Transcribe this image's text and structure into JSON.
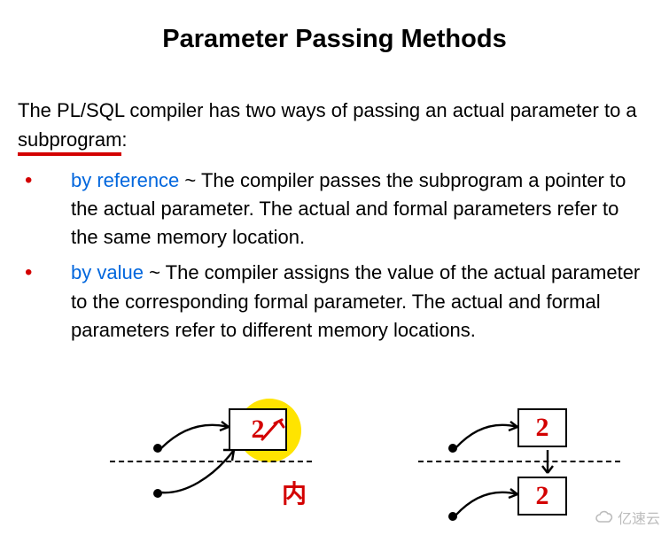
{
  "title": "Parameter Passing Methods",
  "intro_before": "The PL/SQL compiler has two ways of passing an actual parameter to a ",
  "intro_underlined": "subprogram",
  "intro_after": ":",
  "bullets": [
    {
      "term": "by reference",
      "sep": " ~ ",
      "desc": "The compiler passes the subprogram a pointer to the actual parameter. The actual and formal parameters refer to the same memory location."
    },
    {
      "term": "by value",
      "sep": " ~ ",
      "desc": "The compiler assigns the value of the actual parameter to the corresponding formal parameter. The actual and formal parameters refer to different memory locations."
    }
  ],
  "diagram_left": {
    "box_value": "2",
    "handwritten_note": "内"
  },
  "diagram_right": {
    "box_top_value": "2",
    "box_bottom_value": "2"
  },
  "watermark_text": "亿速云"
}
